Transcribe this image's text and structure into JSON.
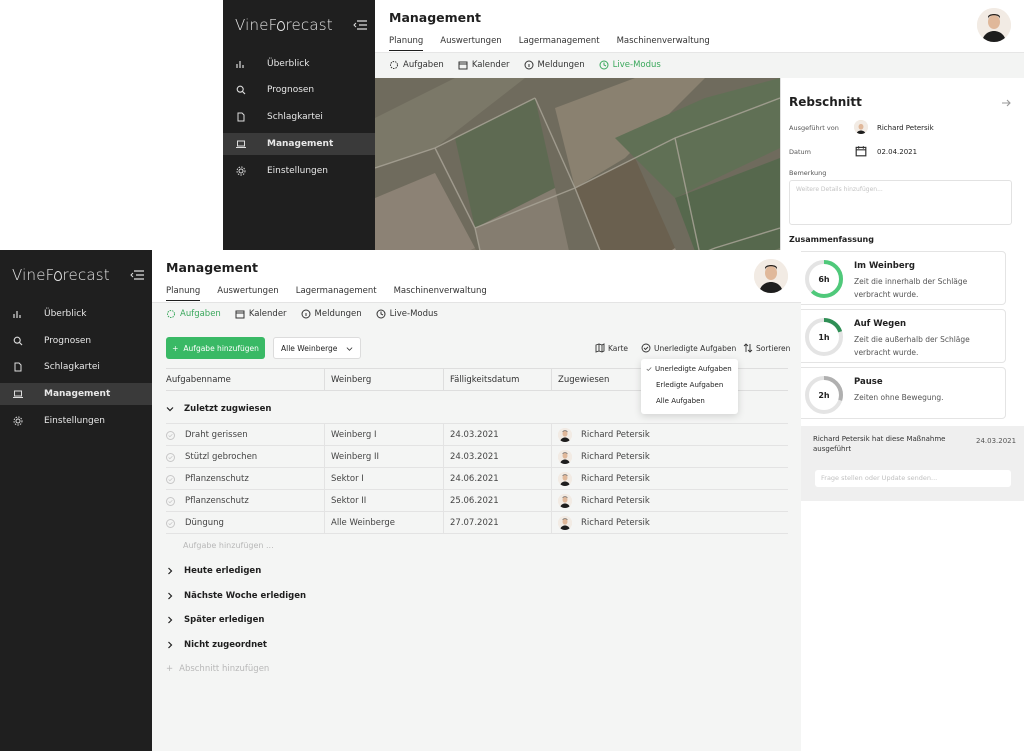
{
  "brand": {
    "name_pre": "Vine",
    "name_post": "recast"
  },
  "nav": [
    {
      "label": "Überblick",
      "icon": "bar-chart-icon"
    },
    {
      "label": "Prognosen",
      "icon": "search-icon"
    },
    {
      "label": "Schlagkartei",
      "icon": "document-icon"
    },
    {
      "label": "Management",
      "icon": "laptop-icon",
      "active": true
    },
    {
      "label": "Einstellungen",
      "icon": "gear-icon"
    }
  ],
  "page_title": "Management",
  "tabs": [
    "Planung",
    "Auswertungen",
    "Lagermanagement",
    "Maschinenverwaltung"
  ],
  "subtabs": [
    "Aufgaben",
    "Kalender",
    "Meldungen",
    "Live-Modus"
  ],
  "detail": {
    "title": "Rebschnitt",
    "performed_by_label": "Ausgeführt von",
    "performed_by": "Richard Petersik",
    "date_label": "Datum",
    "date": "02.04.2021",
    "remark_label": "Bemerkung",
    "remark_placeholder": "Weitere Details hinzufügen...",
    "summary_label": "Zusammenfassung",
    "cards": [
      {
        "ring": "6h",
        "title": "Im Weinberg",
        "desc": "Zeit die innerhalb der Schläge verbracht wurde.",
        "fraction": 0.62
      },
      {
        "ring": "1h",
        "title": "Auf Wegen",
        "desc": "Zeit die außerhalb der Schläge verbracht wurde.",
        "fraction": 0.2
      },
      {
        "ring": "2h",
        "title": "Pause",
        "desc": "Zeiten ohne Bewegung.",
        "fraction": 0.3
      }
    ],
    "activity": "Richard Petersik hat diese Maßnahme ausgeführt",
    "activity_date": "24.03.2021",
    "comment_placeholder": "Frage stellen oder Update senden..."
  },
  "toolbar": {
    "add_task": "Aufgabe hinzufügen",
    "vineyard_filter": "Alle Weinberge",
    "map": "Karte",
    "filter": "Unerledigte Aufgaben",
    "sort": "Sortieren"
  },
  "filter_options": [
    "Unerledigte Aufgaben",
    "Erledigte Aufgaben",
    "Alle Aufgaben"
  ],
  "table": {
    "headers": [
      "Aufgabenname",
      "Weinberg",
      "Fälligkeitsdatum",
      "Zugewiesen"
    ],
    "section": "Zuletzt zugwiesen",
    "rows": [
      {
        "name": "Draht gerissen",
        "vineyard": "Weinberg I",
        "date": "24.03.2021",
        "assignee": "Richard Petersik"
      },
      {
        "name": "Stützl gebrochen",
        "vineyard": "Weinberg II",
        "date": "24.03.2021",
        "assignee": "Richard Petersik"
      },
      {
        "name": "Pflanzenschutz",
        "vineyard": "Sektor I",
        "date": "24.06.2021",
        "assignee": "Richard Petersik"
      },
      {
        "name": "Pflanzenschutz",
        "vineyard": "Sektor II",
        "date": "25.06.2021",
        "assignee": "Richard Petersik"
      },
      {
        "name": "Düngung",
        "vineyard": "Alle Weinberge",
        "date": "27.07.2021",
        "assignee": "Richard Petersik"
      }
    ],
    "add_task_inline": "Aufgabe hinzufügen ...",
    "other_sections": [
      "Heute erledigen",
      "Nächste Woche erledigen",
      "Später erledigen",
      "Nicht zugeordnet"
    ],
    "add_section": "Abschnitt hinzufügen"
  }
}
